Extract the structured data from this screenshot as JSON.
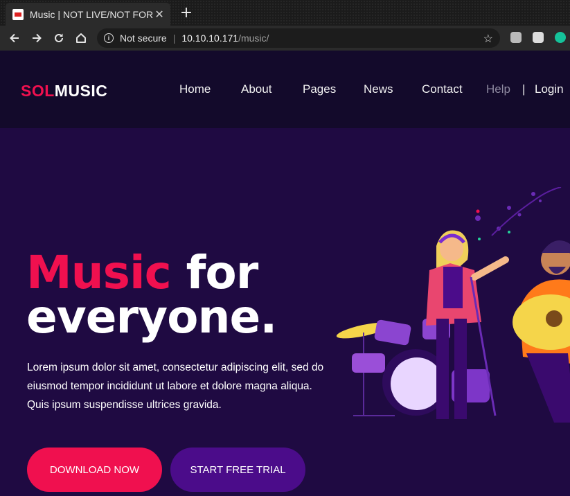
{
  "browser": {
    "tab_title": "Music | NOT LIVE/NOT FOR PRODUCTION USE",
    "tab_close": "✕",
    "new_tab": "+",
    "security_label": "Not secure",
    "url_host": "10.10.10.171",
    "url_path": "/music/"
  },
  "site": {
    "logo_sol": "SOL",
    "logo_music": "MUSIC",
    "nav": {
      "home": "Home",
      "about": "About",
      "pages": "Pages",
      "news": "News",
      "contact": "Contact",
      "help": "Help",
      "divider": "|",
      "login": "Login"
    }
  },
  "hero": {
    "headline_accent": "Music",
    "headline_rest1": " for",
    "headline_rest2": "everyone.",
    "paragraph": "Lorem ipsum dolor sit amet, consectetur adipiscing elit, sed do eiusmod tempor incididunt ut labore et dolore magna aliqua. Quis ipsum suspendisse ultrices gravida.",
    "download_button": "DOWNLOAD NOW",
    "trial_button": "START FREE TRIAL"
  },
  "colors": {
    "accent": "#f0104f",
    "secondary": "#4b0c8a",
    "header_bg": "#130a2b",
    "hero_bg": "#1f0a42"
  },
  "icons": [
    "back-arrow-icon",
    "forward-arrow-icon",
    "reload-icon",
    "home-icon",
    "info-icon",
    "star-icon",
    "extension-icons"
  ]
}
